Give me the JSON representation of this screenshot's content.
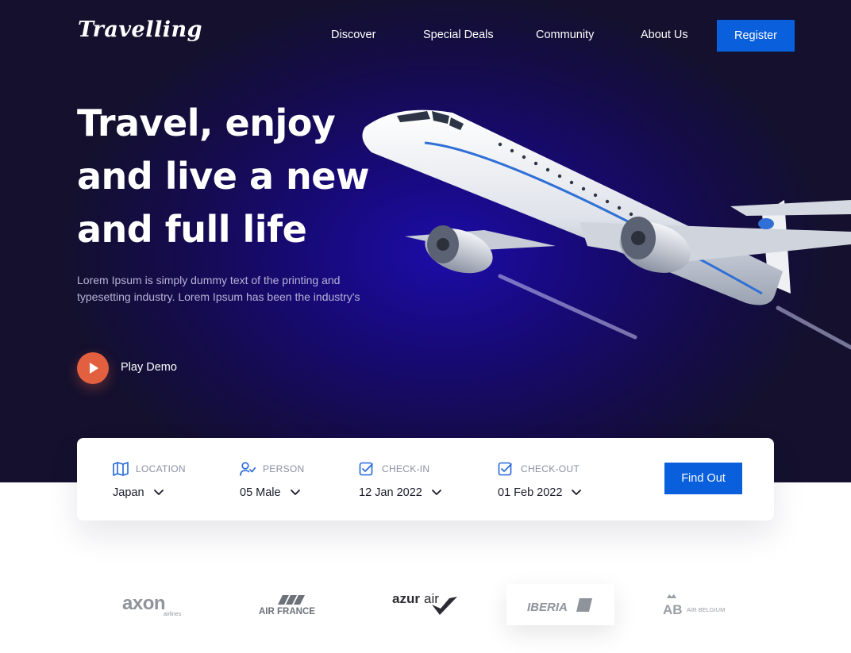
{
  "brand": {
    "name": "Travelling"
  },
  "nav": {
    "items": [
      "Discover",
      "Special Deals",
      "Community",
      "About Us"
    ],
    "register_label": "Register"
  },
  "hero": {
    "headline_lines": [
      "Travel, enjoy",
      "and live a new",
      "and full life"
    ],
    "subtitle": "Lorem Ipsum is simply dummy text of the printing and typesetting industry. Lorem Ipsum has been the industry's",
    "play_label": "Play Demo"
  },
  "search": {
    "fields": [
      {
        "label": "LOCATION",
        "value": "Japan",
        "icon": "map-icon"
      },
      {
        "label": "PERSON",
        "value": "05 Male",
        "icon": "user-check-icon"
      },
      {
        "label": "CHECK-IN",
        "value": "12 Jan 2022",
        "icon": "checkbox-icon"
      },
      {
        "label": "CHECK-OUT",
        "value": "01 Feb 2022",
        "icon": "checkbox-icon"
      }
    ],
    "button_label": "Find Out"
  },
  "partners": {
    "axon": "axon",
    "axon_sub": "airlines",
    "air_france": "AIR FRANCE",
    "azur": "azur",
    "azur_air": "air",
    "iberia": "IBERIA",
    "ab": "AB",
    "ab_sub": "AIR BELGIUM"
  },
  "colors": {
    "accent": "#0a5fdc",
    "play": "#e2603f",
    "hero_bg": "#150b4d"
  }
}
